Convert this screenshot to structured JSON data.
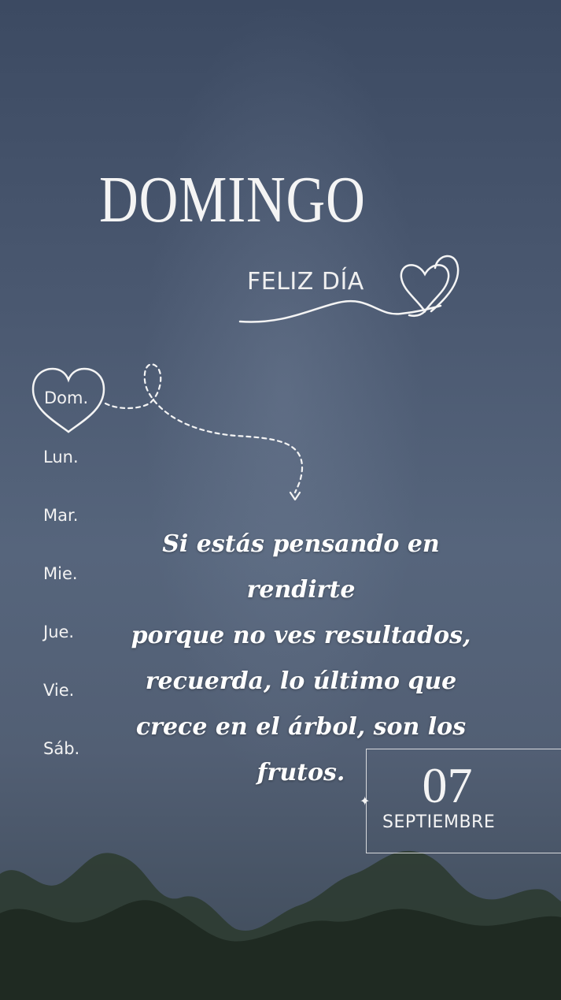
{
  "header": {
    "title": "DOMINGO",
    "subtitle": "FELIZ DÍA"
  },
  "week": {
    "days": [
      "Dom.",
      "Lun.",
      "Mar.",
      "Mie.",
      "Jue.",
      "Vie.",
      "Sáb."
    ],
    "active": "Dom."
  },
  "quote": {
    "lines": [
      "Si estás pensando en rendirte",
      "porque no ves resultados,",
      "recuerda, lo último que",
      "crece en el árbol, son los",
      "frutos."
    ]
  },
  "date": {
    "day": "07",
    "month": "SEPTIEMBRE"
  },
  "icons": [
    "heart-outline-icon",
    "double-heart-icon",
    "sparkle-icon",
    "dashed-arrow-icon"
  ],
  "colors": {
    "background": "#4a5870",
    "text": "#f2f2f2"
  }
}
